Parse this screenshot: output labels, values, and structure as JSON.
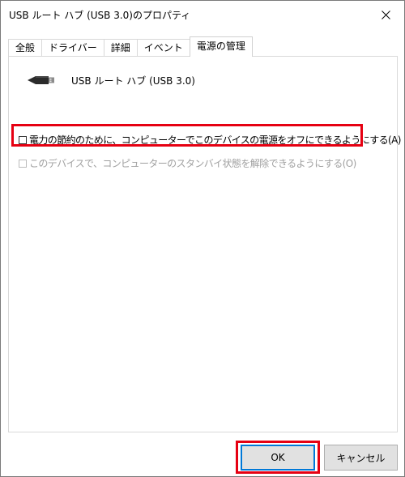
{
  "window": {
    "title": "USB ルート ハブ (USB 3.0)のプロパティ"
  },
  "tabs": [
    {
      "label": "全般"
    },
    {
      "label": "ドライバー"
    },
    {
      "label": "詳細"
    },
    {
      "label": "イベント"
    },
    {
      "label": "電源の管理",
      "active": true
    }
  ],
  "device": {
    "icon": "usb-plug-icon",
    "name": "USB ルート ハブ (USB 3.0)"
  },
  "options": {
    "allow_power_off": {
      "label": "電力の節約のために、コンピューターでこのデバイスの電源をオフにできるようにする(A)",
      "checked": false,
      "enabled": true
    },
    "allow_wake": {
      "label": "このデバイスで、コンピューターのスタンバイ状態を解除できるようにする(O)",
      "checked": false,
      "enabled": false
    }
  },
  "buttons": {
    "ok": "OK",
    "cancel": "キャンセル"
  },
  "colors": {
    "highlight": "#e60012",
    "focus": "#0078d7"
  }
}
